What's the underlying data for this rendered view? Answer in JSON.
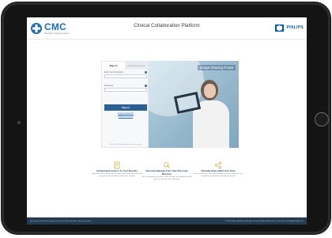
{
  "header": {
    "logo_title": "CMC",
    "logo_subtitle": "Medical Imaging Portal",
    "app_title": "Clinical Collaboration Platform",
    "brand_box": "logo",
    "brand_name": "PHILIPS"
  },
  "login": {
    "tab_signin": "Sign In",
    "tab_register": "Activate Account",
    "username_label": "Enter Your Username",
    "password_label": "Password",
    "signin_button": "Sign In",
    "forgot_link": "Forgot password?",
    "access_link": "Request Access",
    "footer_text": "New Users? Click Activate Account to register"
  },
  "hero": {
    "label": "Image Sharing Portal"
  },
  "features": [
    {
      "title": "On-Demand Access To Your Results",
      "desc": "Book your current and previous exam results and view your exam images through the online portal, when needed."
    },
    {
      "title": "Securely Manage Your Own Personal Records",
      "desc": "You can manage your online health records, with additional family users to help you view / download."
    },
    {
      "title": "Virtually Share With Your Care",
      "desc": "You can share your data with clinicians you trust, giving access, authorization capabilities through this portal."
    }
  ],
  "footer": {
    "left": "By using this website you agree to the terms of the disclaimer and privacy policy.",
    "right": "© 2023 Philips Healthcare. All rights reserved. Philips Healthcare is a division of Koninklijke Philips N.V."
  },
  "colors": {
    "accent": "#1e6fb5",
    "footer_bg": "#243b52",
    "button": "#2c5f92",
    "feature_icon": "#c8b24a"
  }
}
